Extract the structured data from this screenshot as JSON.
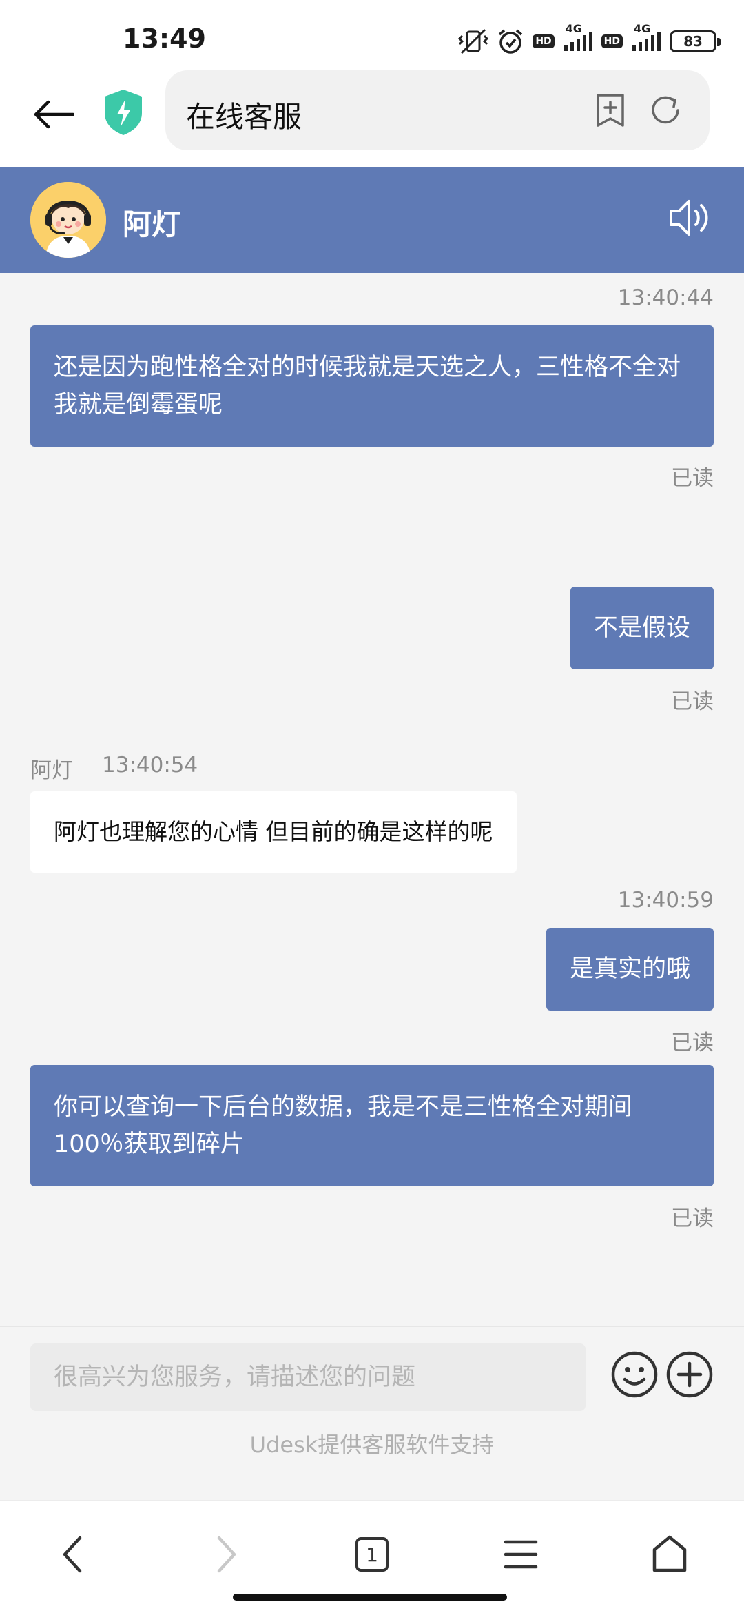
{
  "status_bar": {
    "time": "13:49",
    "hd1": "HD",
    "net1": "4G",
    "hd2": "HD",
    "net2": "4G",
    "battery": "83",
    "icons": [
      "mute-vibrate-icon",
      "alarm-icon",
      "hd-icon",
      "signal-icon",
      "hd-icon",
      "signal-icon",
      "battery-icon"
    ]
  },
  "browser": {
    "page_title": "在线客服",
    "icons": [
      "back-arrow-icon",
      "shield-icon",
      "bookmark-add-icon",
      "refresh-icon"
    ]
  },
  "chat_header": {
    "agent_name": "阿灯",
    "icons": [
      "avatar-agent-icon",
      "speaker-icon"
    ]
  },
  "messages": [
    {
      "side": "right",
      "timestamp": "13:40:44",
      "text": "还是因为跑性格全对的时候我就是天选之人，三性格不全对我就是倒霉蛋呢",
      "status": "已读"
    },
    {
      "side": "right",
      "text": "不是假设",
      "status": "已读"
    },
    {
      "side": "left",
      "sender": "阿灯",
      "timestamp": "13:40:54",
      "text": "阿灯也理解您的心情 但目前的确是这样的呢"
    },
    {
      "side": "right",
      "timestamp": "13:40:59",
      "text": "是真实的哦",
      "status": "已读"
    },
    {
      "side": "right",
      "text": "你可以查询一下后台的数据，我是不是三性格全对期间100％获取到碎片",
      "status": "已读"
    }
  ],
  "input": {
    "placeholder": "很高兴为您服务，请描述您的问题",
    "value": "",
    "powered_by": "Udesk提供客服软件支持",
    "icons": [
      "emoji-icon",
      "plus-icon"
    ]
  },
  "bottom_nav": {
    "tab_count": "1",
    "icons": [
      "nav-back-icon",
      "nav-forward-icon",
      "tabs-icon",
      "menu-icon",
      "home-icon"
    ]
  },
  "colors": {
    "accent": "#5f7ab5",
    "background": "#f4f4f4",
    "bubble_left": "#ffffff",
    "muted_text": "#8a8a8a",
    "shield": "#3cc9a8",
    "avatar_bg": "#fbd06a"
  }
}
